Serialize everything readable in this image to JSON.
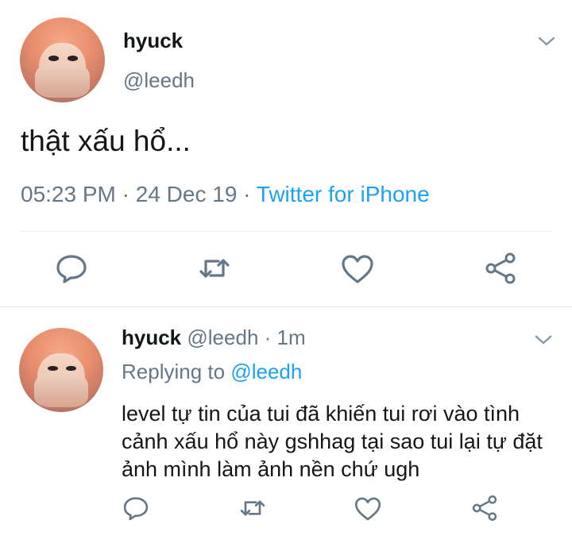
{
  "main_tweet": {
    "name": "hyuck",
    "handle": "@leedh",
    "text": "thật xấu hổ...",
    "time": "05:23 PM",
    "sep1": " · ",
    "date": "24 Dec 19",
    "sep2": " · ",
    "source": "Twitter for iPhone"
  },
  "reply_tweet": {
    "name": "hyuck",
    "handle": "@leedh",
    "sep": " · ",
    "age": "1m",
    "replying_label": "Replying to ",
    "replying_to": "@leedh",
    "text": "level tự tin của tui đã khiến tui rơi vào tình cảnh xấu hổ này gshhag tại sao tui lại tự đặt ảnh mình làm ảnh nền chứ ugh"
  },
  "icons": [
    "reply-icon",
    "retweet-icon",
    "like-icon",
    "share-icon",
    "chevron-down-icon"
  ],
  "colors": {
    "accent": "#1da1f2",
    "muted": "#657786",
    "text": "#14171a",
    "icon": "#657786"
  }
}
